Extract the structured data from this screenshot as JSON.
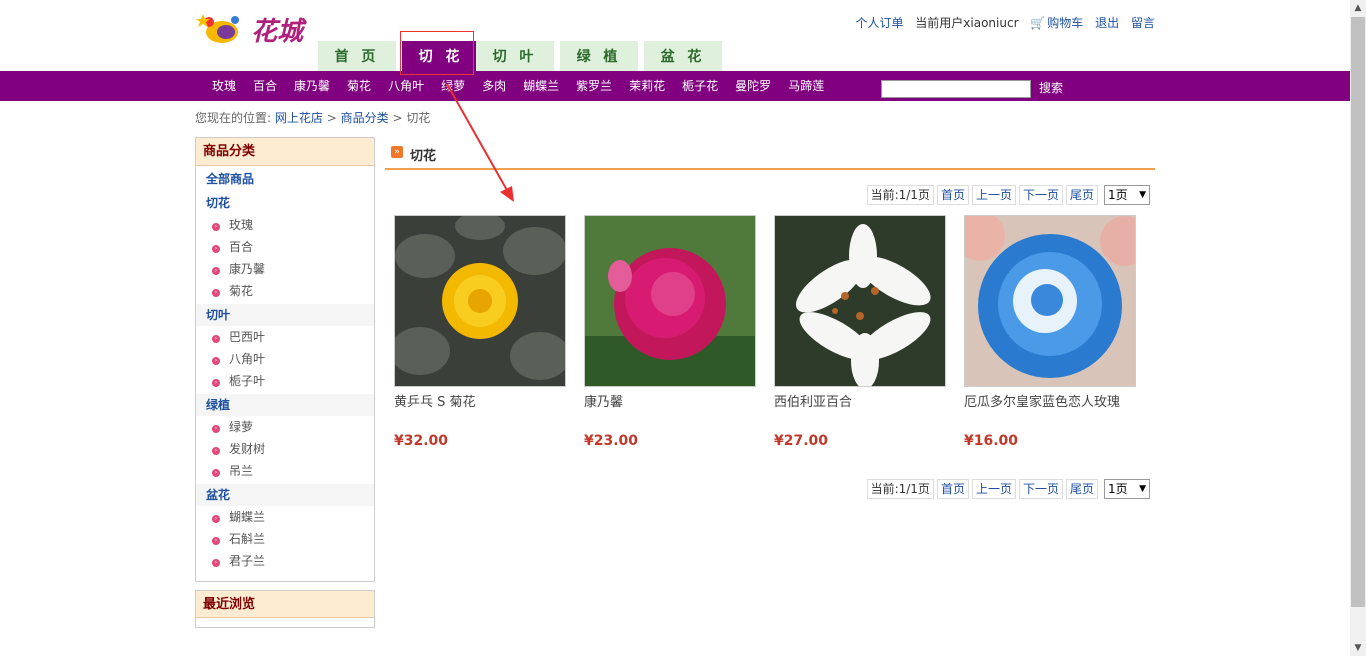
{
  "brand": {
    "logo_text": "花城"
  },
  "top_links": {
    "orders": "个人订单",
    "current_user": "当前用户xiaoniucr",
    "cart": "购物车",
    "logout": "退出",
    "message": "留言"
  },
  "tabs": [
    {
      "label": "首 页"
    },
    {
      "label": "切 花"
    },
    {
      "label": "切 叶"
    },
    {
      "label": "绿 植"
    },
    {
      "label": "盆 花"
    }
  ],
  "nav": {
    "items": [
      "玫瑰",
      "百合",
      "康乃馨",
      "菊花",
      "八角叶",
      "绿萝",
      "多肉",
      "蝴蝶兰",
      "紫罗兰",
      "茉莉花",
      "栀子花",
      "曼陀罗",
      "马蹄莲"
    ],
    "search_value": "",
    "search_label": "搜索"
  },
  "breadcrumb": {
    "prefix": "您现在的位置:",
    "home": "网上花店",
    "sep1": ">",
    "category": "商品分类",
    "sep2": ">",
    "current": "切花"
  },
  "sidebar": {
    "title": "商品分类",
    "all": "全部商品",
    "groups": [
      {
        "name": "切花",
        "items": [
          "玫瑰",
          "百合",
          "康乃馨",
          "菊花"
        ]
      },
      {
        "name": "切叶",
        "items": [
          "巴西叶",
          "八角叶",
          "栀子叶"
        ]
      },
      {
        "name": "绿植",
        "items": [
          "绿萝",
          "发财树",
          "吊兰"
        ]
      },
      {
        "name": "盆花",
        "items": [
          "蝴蝶兰",
          "石斛兰",
          "君子兰"
        ]
      }
    ],
    "recent_title": "最近浏览"
  },
  "main": {
    "title": "切花",
    "pager": {
      "current": "当前:1/1页",
      "first": "首页",
      "prev": "上一页",
      "next": "下一页",
      "last": "尾页",
      "select": "1页"
    },
    "products": [
      {
        "name": "黄乒乓 S 菊花",
        "price": "¥32.00",
        "image": "yellow-chrysanthemum"
      },
      {
        "name": "康乃馨",
        "price": "¥23.00",
        "image": "pink-peony"
      },
      {
        "name": "西伯利亚百合",
        "price": "¥27.00",
        "image": "white-lily"
      },
      {
        "name": "厄瓜多尔皇家蓝色恋人玫瑰",
        "price": "¥16.00",
        "image": "blue-rose"
      }
    ]
  },
  "colors": {
    "accent": "#800080",
    "price": "#c0392b",
    "link": "#1e50a2",
    "tab_bg": "#dff0dc"
  }
}
